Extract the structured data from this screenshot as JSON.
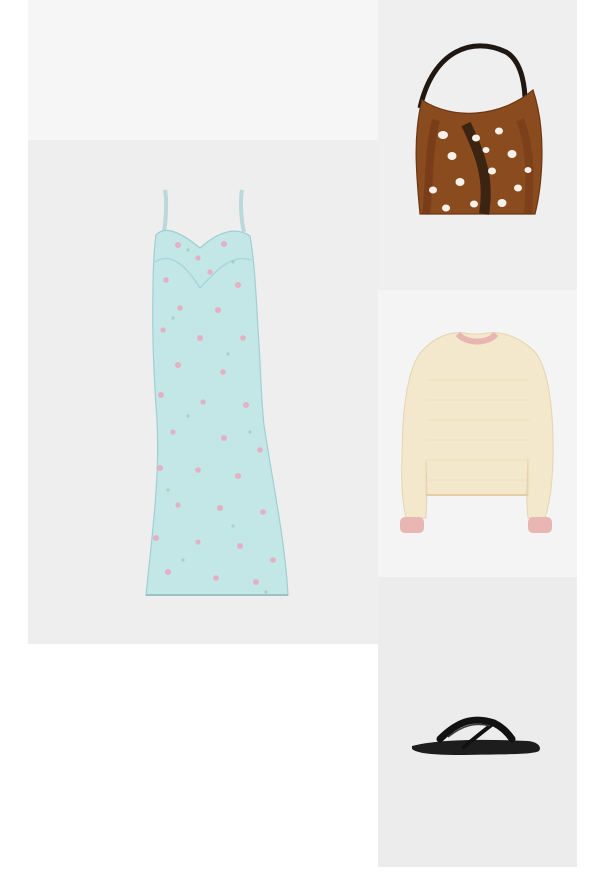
{
  "collage": {
    "items": [
      {
        "id": "dress",
        "kind": "floral slip midi dress",
        "color": "#bfe6e8",
        "accent": "#e7a7bf"
      },
      {
        "id": "bag",
        "kind": "faux fur hobo bag",
        "color": "#8a4b1f",
        "accent": "#f4efe8"
      },
      {
        "id": "sweatshirt",
        "kind": "cream sweatshirt with pink trim",
        "color": "#f3e8ce",
        "accent": "#e7b7b3"
      },
      {
        "id": "sandal",
        "kind": "black leather thong sandal",
        "color": "#1d1d1d"
      }
    ]
  }
}
